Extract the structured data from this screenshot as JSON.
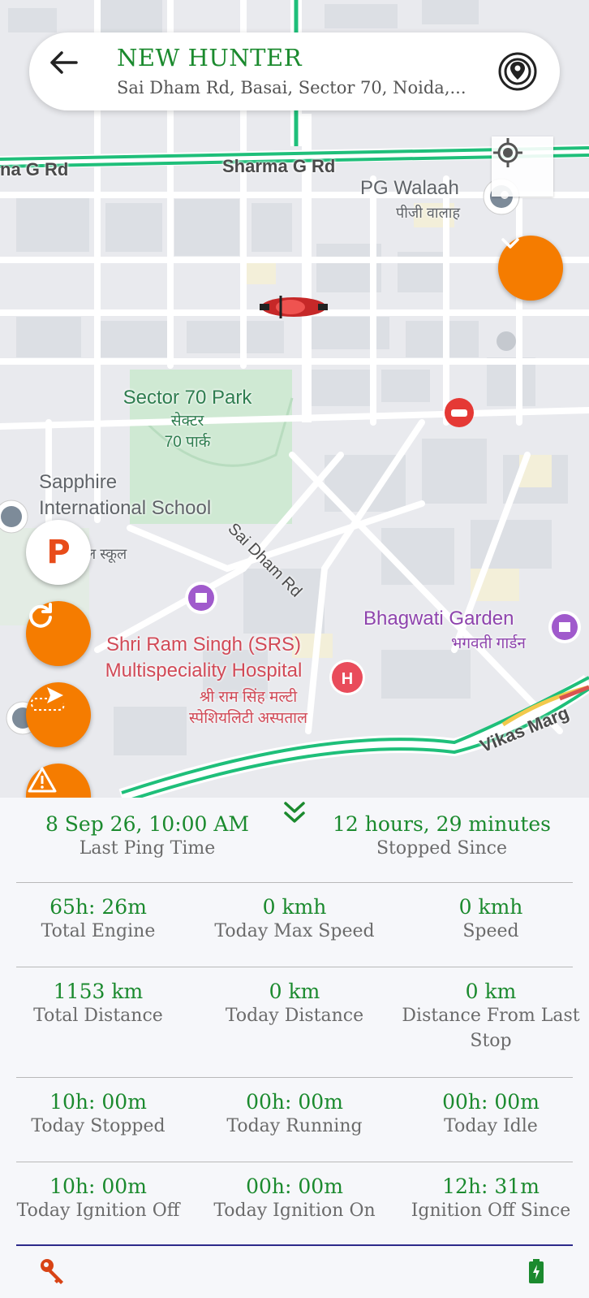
{
  "header": {
    "vehicle_name": "NEW HUNTER",
    "address": "Sai Dham Rd, Basai, Sector 70, Noida,..."
  },
  "map": {
    "road_labels": {
      "sharma_left": "na G Rd",
      "sharma_main": "Sharma G Rd",
      "sai_dham": "Sai Dham Rd",
      "vikas": "Vikas Marg"
    },
    "pois": {
      "pg_walaah": "PG Walaah",
      "pg_walaah_hi": "पीजी वालाह",
      "park_line1": "Sector 70 Park",
      "park_hi_line1": "सेक्टर",
      "park_hi_line2": "70 पार्क",
      "school_line1": "Sapphire",
      "school_line2": "International School",
      "school_hi": "ल स्कूल",
      "garden": "Bhagwati Garden",
      "garden_hi": "भगवती गार्डन",
      "hospital_line1": "Shri Ram Singh (SRS)",
      "hospital_line2": "Multispeciality Hospital",
      "hospital_hi_line1": "श्री राम सिंह मल्टी",
      "hospital_hi_line2": "स्पेशियलिटी अस्पताल"
    },
    "parking_label": "P"
  },
  "status": {
    "last_ping_time": {
      "value": "8 Sep 26, 10:00 AM",
      "label": "Last Ping Time"
    },
    "stopped_since": {
      "value": "12 hours, 29 minutes",
      "label": "Stopped Since"
    }
  },
  "stats_rows": [
    [
      {
        "value": "65h: 26m",
        "label": "Total Engine"
      },
      {
        "value": "0 kmh",
        "label": "Today Max Speed"
      },
      {
        "value": "0 kmh",
        "label": "Speed"
      }
    ],
    [
      {
        "value": "1153 km",
        "label": "Total Distance"
      },
      {
        "value": "0 km",
        "label": "Today Distance"
      },
      {
        "value": "0 km",
        "label": "Distance From Last Stop"
      }
    ],
    [
      {
        "value": "10h: 00m",
        "label": "Today Stopped"
      },
      {
        "value": "00h: 00m",
        "label": "Today Running"
      },
      {
        "value": "00h: 00m",
        "label": "Today Idle"
      }
    ],
    [
      {
        "value": "10h: 00m",
        "label": "Today Ignition Off"
      },
      {
        "value": "00h: 00m",
        "label": "Today Ignition On"
      },
      {
        "value": "12h: 31m",
        "label": "Ignition Off Since"
      }
    ]
  ],
  "colors": {
    "accent_green": "#1b8a2e",
    "orange": "#f57c00",
    "divider_blue": "#2d2a8a"
  },
  "icons": {
    "back": "arrow-left-icon",
    "live": "live-location-icon",
    "locate": "my-location-icon",
    "collapse": "chevron-down-icon",
    "parking": "parking-icon",
    "refresh": "refresh-icon",
    "route": "route-icon",
    "alert": "alert-icon",
    "drawer": "double-chevron-down-icon",
    "key": "key-icon",
    "battery": "battery-charging-icon"
  }
}
